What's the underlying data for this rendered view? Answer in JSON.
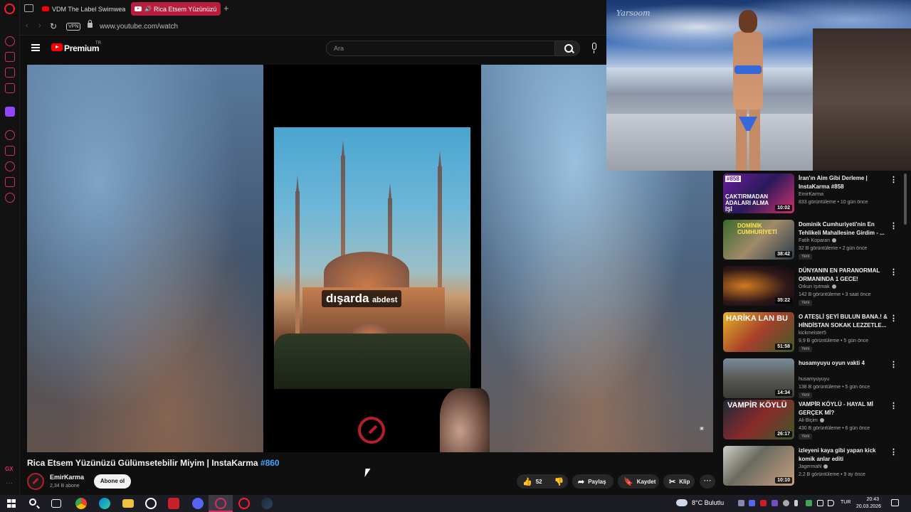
{
  "browser": {
    "tabs": [
      {
        "label": "VDM The Label Swimwear",
        "active": false
      },
      {
        "label": "Rica Etsem Yüzünüzü",
        "active": true
      }
    ],
    "vpn_label": "VPN",
    "url": "www.youtube.com/watch",
    "accent_color": "#d6305a"
  },
  "youtube": {
    "logo_text": "Premium",
    "region": "TR",
    "search_placeholder": "Ara"
  },
  "player": {
    "caption_big": "dışarda",
    "caption_small": "abdest"
  },
  "video": {
    "title": "Rica Etsem Yüzünüzü Gülümsetebilir Miyim | InstaKarma ",
    "hashtag": "#860",
    "channel": "EmirKarma",
    "subscribers": "2,34 B abone",
    "subscribe_label": "Abone ol",
    "likes": "52",
    "share_label": "Paylaş",
    "save_label": "Kaydet",
    "clip_label": "Klip"
  },
  "related": [
    {
      "title": "İran'ın Aim Gibi Derleme | InstaKarma #858",
      "channel": "EmirKarma",
      "verified": false,
      "meta": "833 görüntüleme • 10 gün önce",
      "duration": "10:02",
      "new": false,
      "thumb_badge": "#858",
      "thumb_text": "ÇAKTIRMADAN ADALARI ALMA İŞİ"
    },
    {
      "title": "Dominik Cumhuriyeti'nin En Tehlikeli Mahallesine Girdim - ...",
      "channel": "Fatih Koparan",
      "verified": true,
      "meta": "32 B görüntüleme • 2 gün önce",
      "duration": "38:42",
      "new": true,
      "thumb_text": "DOMİNİK CUMHURİYETİ"
    },
    {
      "title": "DÜNYANIN EN PARANORMAL ORMANINDA 1 GECE!",
      "channel": "Orkun Işıtmak",
      "verified": true,
      "meta": "142 B görüntüleme • 3 saat önce",
      "duration": "35:22",
      "new": true
    },
    {
      "title": "O ATEŞLİ ŞEYİ BULUN BANA.! & HİNDİSTAN SOKAK LEZZETLE...",
      "channel": "kickmeister5",
      "verified": false,
      "meta": "9,9 B görüntüleme • 5 gün önce",
      "duration": "51:58",
      "new": true,
      "thumb_text": "HARİKA LAN BU"
    },
    {
      "title": "husamyuyu oyun vakti 4",
      "channel": "husamyuyuyu",
      "verified": false,
      "meta": "138 B görüntüleme • 5 gün önce",
      "duration": "14:34",
      "new": true
    },
    {
      "title": "VAMPİR KÖYLÜ - HAYAL Mİ GERÇEK Mİ?",
      "channel": "Ali Biçim",
      "verified": true,
      "meta": "430 B görüntüleme • 6 gün önce",
      "duration": "26:17",
      "new": true,
      "thumb_text": "VAMPİR KÖYLÜ"
    },
    {
      "title": "izleyeni kaya gibi yapan kick komik anlar editi",
      "channel": "JagermaN",
      "verified": true,
      "meta": "2,2 B görüntüleme • 9 ay önce",
      "duration": "10:10",
      "new": false
    }
  ],
  "taskbar": {
    "weather": "8°C  Bulutlu",
    "language": "TUR",
    "time": "20:43",
    "date": "20.03.2026"
  }
}
